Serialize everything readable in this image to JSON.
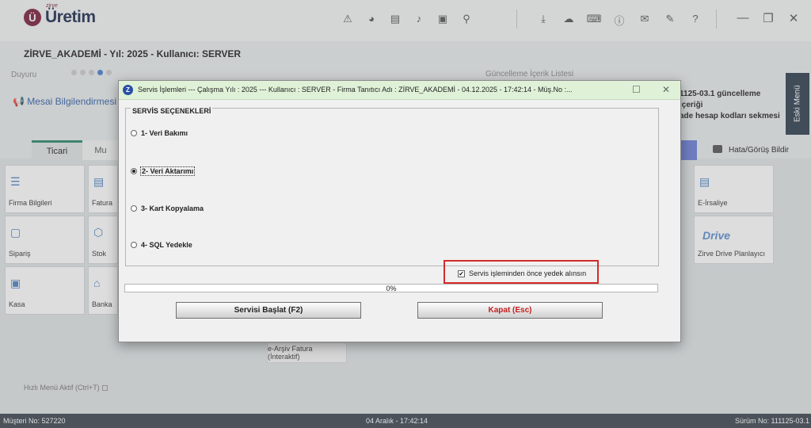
{
  "app": {
    "logo_brand_small": "zirve",
    "logo_brand": "Üretim",
    "logo_mark": "Ü",
    "company_line": "ZİRVE_AKADEMİ - Yıl: 2025 - Kullanıcı: SERVER"
  },
  "header_icons": [
    "warning-icon",
    "chart-icon",
    "panel-icon",
    "bell-icon",
    "money-icon",
    "location-icon",
    "download-icon",
    "cloud-icon",
    "keyboard-icon",
    "info-icon",
    "chat-icon",
    "edit-icon",
    "help-icon"
  ],
  "window_controls": [
    "minimize-icon",
    "restore-icon",
    "close-icon"
  ],
  "announcements": {
    "duyuru_label": "Duyuru",
    "update_list_title": "Güncelleme İçerik Listesi",
    "mesai_text": "Mesai Bilgilendirmesi |",
    "update_note_line1": "1125-03.1 güncelleme içeriği",
    "update_note_line2": "ade hesap kodları sekmesi",
    "eski_menu": "Eski Menü"
  },
  "tabs": {
    "active": "Ticari",
    "second": "Mu",
    "hata_bildir": "Hata/Görüş Bildir"
  },
  "cards": {
    "firma": "Firma Bilgileri",
    "fatura": "Fatura",
    "siparis": "Sipariş",
    "stok": "Stok",
    "kasa": "Kasa",
    "banka": "Banka",
    "eirsaliye": "E-İrsaliye",
    "drive_logo": "Drive",
    "drive": "Zirve Drive Planlayıcı",
    "earsiv": "e-Arşiv Fatura (İnteraktif)"
  },
  "hizli_menu": "Hızlı Menü Aktif (Ctrl+T)",
  "status": {
    "musteri": "Müşteri No: 527220",
    "datetime": "04 Aralık - 17:42:14",
    "surum": "Sürüm No: 111125-03.1"
  },
  "dialog": {
    "icon_letter": "Z",
    "title": "Servis İşlemleri  ---  Çalışma Yılı : 2025  ---  Kullanıcı : SERVER - Firma Tanıtıcı Adı : ZİRVE_AKADEMİ - 04.12.2025 - 17:42:14 - Müş.No :...",
    "group_title": "SERVİS SEÇENEKLERİ",
    "options": [
      {
        "label": "1- Veri Bakımı",
        "selected": false
      },
      {
        "label": "2- Veri Aktarımı",
        "selected": true
      },
      {
        "label": "3- Kart Kopyalama",
        "selected": false
      },
      {
        "label": "4- SQL Yedekle",
        "selected": false
      }
    ],
    "backup_checkbox_label": "Servis işleminden önce yedek alınsın",
    "backup_checked": true,
    "progress_text": "0%",
    "progress_fraction": 0,
    "start_button": "Servisi Başlat (F2)",
    "close_button": "Kapat (Esc)",
    "colors": {
      "title_bg": "#dff2d8",
      "highlight": "#d42a2a",
      "close_text": "#c41e1e"
    }
  }
}
